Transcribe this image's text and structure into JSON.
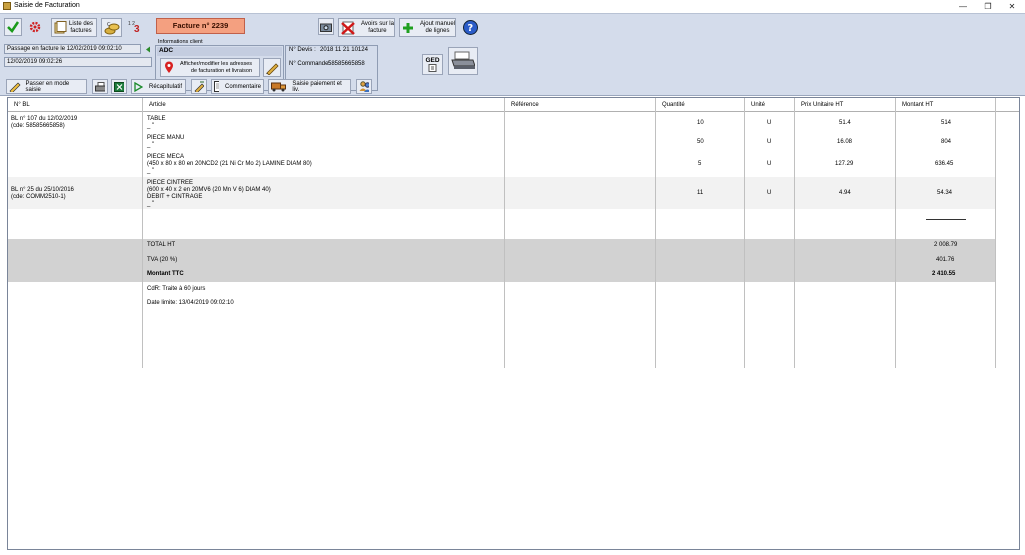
{
  "window": {
    "title": "Saisie de Facturation"
  },
  "toolbar": {
    "liste_label": "Liste des\nfactures",
    "facture_label": "Facture n° 2239",
    "avoirs_label": "Avoirs sur la\nfacture",
    "ajout_label": "Ajout manuel\nde lignes",
    "num_icon_text": "3",
    "num_icon_small": "1 2",
    "ged_label": "GED"
  },
  "status": {
    "passage": "Passage en facture le 12/02/2019 09:02:10",
    "date": "12/02/2019 09:02:26"
  },
  "client": {
    "group_title": "Informations client",
    "name": "ADC",
    "address_button": "Afficher/modifier les adresses\nde facturation et livraison"
  },
  "devis": {
    "devis_label": "N° Devis :",
    "devis_value": "2018 11 21 10124",
    "commande_label": "N° Commande:",
    "commande_value": "58585665858"
  },
  "toolbar2": {
    "saisie_mode": "Passer en mode saisie",
    "recap": "Récapitulatif",
    "commentaire": "Commentaire",
    "paiement": "Saisie paiement et liv."
  },
  "grid": {
    "headers": [
      "N° BL",
      "Article",
      "Référence",
      "Quantité",
      "Unité",
      "Prix Unitaire HT",
      "Montant HT"
    ],
    "bl1_line1": "BL n° 107 du 12/02/2019",
    "bl1_line2": "(cde: 58585665858)",
    "bl2_line1": "BL n° 25 du 25/10/2016",
    "bl2_line2": "(cde: COMM2510-1)",
    "rows": [
      {
        "article": "TABLE",
        "sub": "_ \"",
        "qty": "10",
        "unit": "U",
        "pu": "51.4",
        "montant": "514"
      },
      {
        "article": "PIECE MANU",
        "sub": "_ \"",
        "qty": "50",
        "unit": "U",
        "pu": "16.08",
        "montant": "804"
      },
      {
        "article": "PIECE MECA",
        "sub": "(450 x 80 x 80  en 20NCD2 (21 Ni Cr Mo 2) LAMINE DIAM 80)",
        "sub2": "_ \"",
        "qty": "5",
        "unit": "U",
        "pu": "127.29",
        "montant": "636.45"
      },
      {
        "article": "PIECE CINTREE",
        "sub": "(600 x 40 x 2  en 20MV6 (20 Mn V 6) DIAM 40)",
        "sub2": "DEBIT + CINTRAGE",
        "sub3": "_ \"",
        "qty": "11",
        "unit": "U",
        "pu": "4.94",
        "montant": "54.34"
      }
    ],
    "totals": {
      "ht_label": "TOTAL HT",
      "ht_value": "2 008.79",
      "tva_label": "TVA (20 %)",
      "tva_value": "401.76",
      "ttc_label": "Montant  TTC",
      "ttc_value": "2 410.55"
    },
    "cdr": "CdR: Traite à  60 jours",
    "date_limite": "Date limite: 13/04/2019 09:02:10"
  }
}
